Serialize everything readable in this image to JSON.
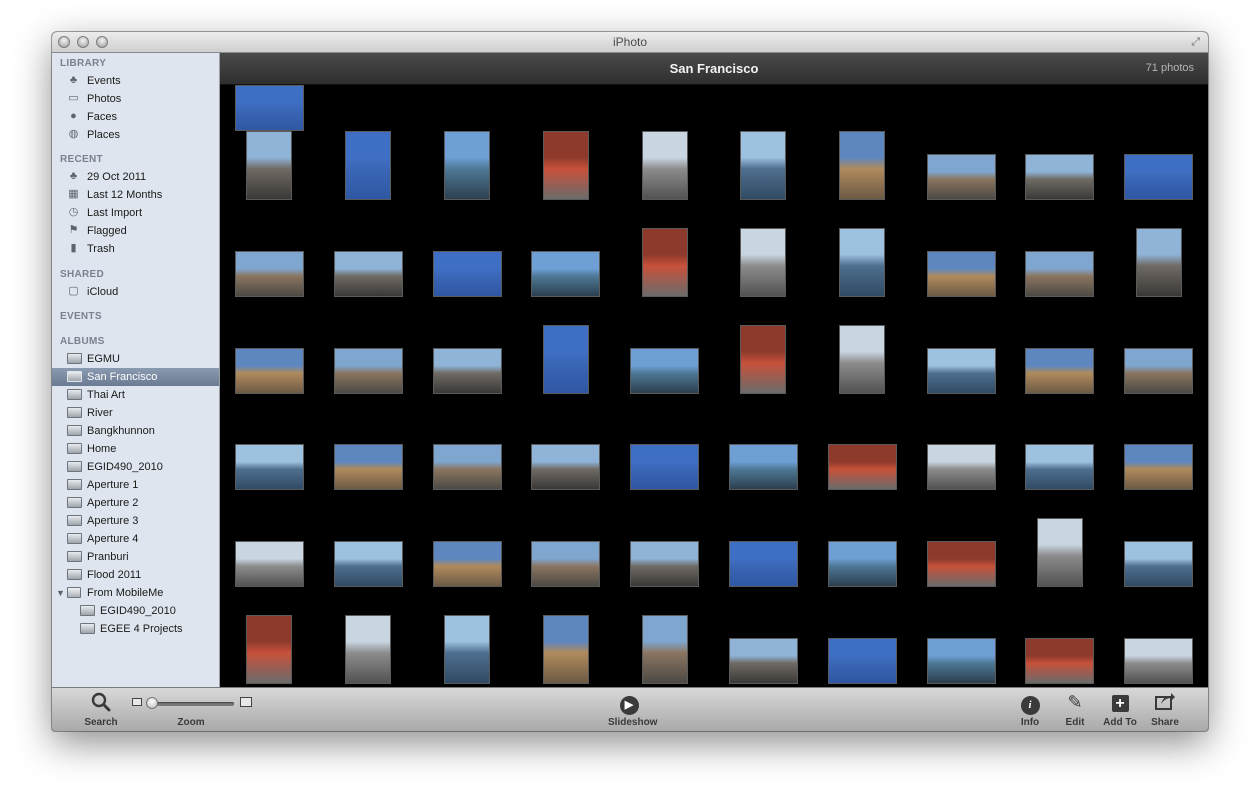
{
  "window": {
    "title": "iPhoto"
  },
  "library": {
    "heading": "LIBRARY",
    "items": [
      {
        "label": "Events",
        "icon": "palm-tree-icon",
        "glyph": "♣"
      },
      {
        "label": "Photos",
        "icon": "photo-stack-icon",
        "glyph": "▭"
      },
      {
        "label": "Faces",
        "icon": "person-icon",
        "glyph": "●"
      },
      {
        "label": "Places",
        "icon": "globe-icon",
        "glyph": "◍"
      }
    ]
  },
  "recent": {
    "heading": "RECENT",
    "items": [
      {
        "label": "29 Oct 2011",
        "icon": "palm-tree-icon",
        "glyph": "♣"
      },
      {
        "label": "Last 12 Months",
        "icon": "calendar-icon",
        "glyph": "▦"
      },
      {
        "label": "Last Import",
        "icon": "clock-icon",
        "glyph": "◷"
      },
      {
        "label": "Flagged",
        "icon": "flag-icon",
        "glyph": "⚑"
      },
      {
        "label": "Trash",
        "icon": "trash-icon",
        "glyph": "▮"
      }
    ]
  },
  "shared": {
    "heading": "SHARED",
    "items": [
      {
        "label": "iCloud",
        "icon": "icloud-icon",
        "glyph": "▢"
      }
    ]
  },
  "events_heading": "EVENTS",
  "albums": {
    "heading": "ALBUMS",
    "items": [
      {
        "label": "EGMU"
      },
      {
        "label": "San Francisco",
        "selected": true
      },
      {
        "label": "Thai Art"
      },
      {
        "label": "River"
      },
      {
        "label": "Bangkhunnon"
      },
      {
        "label": "Home"
      },
      {
        "label": "EGID490_2010"
      },
      {
        "label": "Aperture 1"
      },
      {
        "label": "Aperture 2"
      },
      {
        "label": "Aperture 3"
      },
      {
        "label": "Aperture 4"
      },
      {
        "label": "Pranburi"
      },
      {
        "label": "Flood 2011"
      },
      {
        "label": "From MobileMe",
        "folder": true
      },
      {
        "label": "EGID490_2010",
        "sub": true
      },
      {
        "label": "EGEE 4 Projects",
        "sub": true
      }
    ]
  },
  "content": {
    "title": "San Francisco",
    "count": "71 photos"
  },
  "photos": [
    "p",
    "p",
    "p",
    "p",
    "p",
    "p",
    "p",
    "l",
    "l",
    "l",
    "l",
    "l",
    "l",
    "l",
    "p",
    "p",
    "p",
    "l",
    "l",
    "p",
    "l",
    "l",
    "l",
    "p",
    "l",
    "p",
    "p",
    "l",
    "l",
    "l",
    "l",
    "l",
    "l",
    "l",
    "l",
    "l",
    "l",
    "l",
    "l",
    "l",
    "l",
    "l",
    "l",
    "l",
    "l",
    "l",
    "l",
    "l",
    "p",
    "l",
    "p",
    "p",
    "p",
    "p",
    "p",
    "l",
    "l",
    "l",
    "l",
    "l",
    "l",
    "l",
    "l",
    "l",
    "l",
    "l",
    "l",
    "l",
    "l",
    "l",
    "l"
  ],
  "toolbar": {
    "search": "Search",
    "zoom": "Zoom",
    "slideshow": "Slideshow",
    "info": "Info",
    "edit": "Edit",
    "add_to": "Add To",
    "share": "Share"
  }
}
